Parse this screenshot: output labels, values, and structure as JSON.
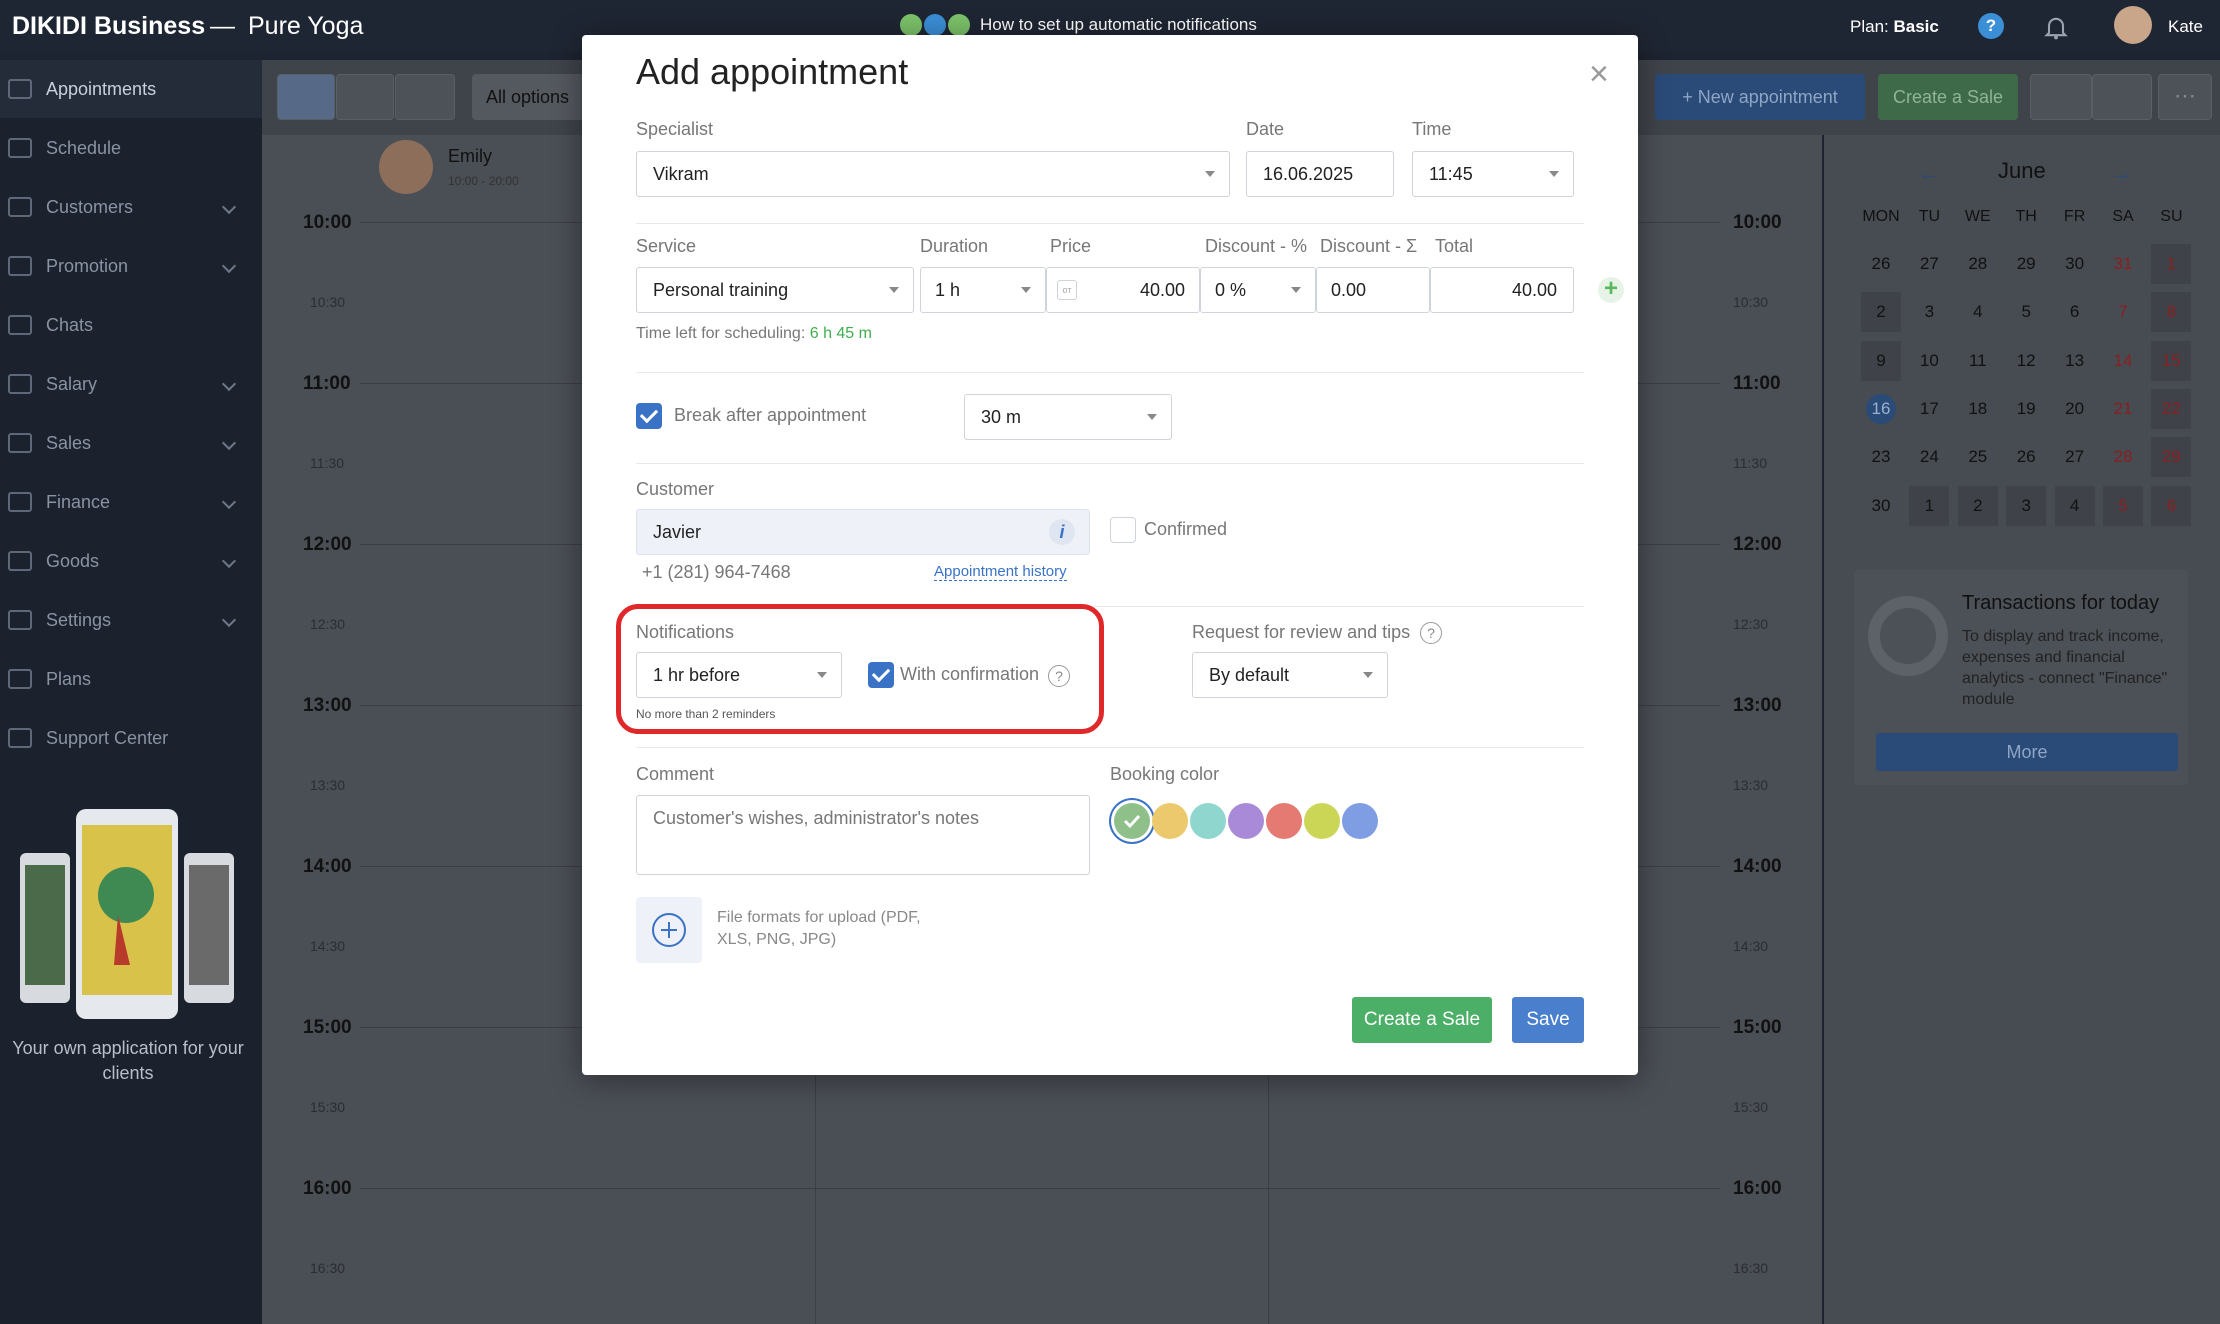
{
  "topbar": {
    "brand": "DIKIDI Business",
    "separator": "—",
    "company": "Pure Yoga",
    "promo_text": "How to set up automatic notifications",
    "plan_label": "Plan:",
    "plan_value": "Basic",
    "help_icon": "?",
    "user_name": "Kate"
  },
  "sidebar": {
    "items": [
      {
        "label": "Appointments",
        "icon": "calendar-icon",
        "active": true,
        "expandable": false
      },
      {
        "label": "Schedule",
        "icon": "schedule-icon",
        "active": false,
        "expandable": false
      },
      {
        "label": "Customers",
        "icon": "users-icon",
        "active": false,
        "expandable": true
      },
      {
        "label": "Promotion",
        "icon": "rocket-icon",
        "active": false,
        "expandable": true
      },
      {
        "label": "Chats",
        "icon": "chat-icon",
        "active": false,
        "expandable": false
      },
      {
        "label": "Salary",
        "icon": "salary-icon",
        "active": false,
        "expandable": true
      },
      {
        "label": "Sales",
        "icon": "sales-icon",
        "active": false,
        "expandable": true
      },
      {
        "label": "Finance",
        "icon": "finance-icon",
        "active": false,
        "expandable": true
      },
      {
        "label": "Goods",
        "icon": "goods-icon",
        "active": false,
        "expandable": true
      },
      {
        "label": "Settings",
        "icon": "gear-icon",
        "active": false,
        "expandable": true
      },
      {
        "label": "Plans",
        "icon": "layers-icon",
        "active": false,
        "expandable": false
      },
      {
        "label": "Support Center",
        "icon": "help-icon",
        "active": false,
        "expandable": false
      }
    ],
    "app_promo": "Your own application for your clients"
  },
  "calendar": {
    "view_filter": "All options",
    "staff_name": "Emily",
    "staff_hours": "10:00 - 20:00",
    "hours": [
      "10:00",
      "11:00",
      "12:00",
      "13:00",
      "14:00",
      "15:00",
      "16:00"
    ],
    "half_hours": [
      "10:30",
      "11:30",
      "12:30",
      "13:30",
      "14:30",
      "15:30",
      "16:30"
    ]
  },
  "right_panel": {
    "new_appointment": "New appointment",
    "create_sale": "Create a Sale",
    "more_icon": "⋯",
    "month": "June",
    "weekdays": [
      "MON",
      "TU",
      "WE",
      "TH",
      "FR",
      "SA",
      "SU"
    ],
    "weeks": [
      [
        "26",
        "27",
        "28",
        "29",
        "30",
        "31",
        "1"
      ],
      [
        "2",
        "3",
        "4",
        "5",
        "6",
        "7",
        "8"
      ],
      [
        "9",
        "10",
        "11",
        "12",
        "13",
        "14",
        "15"
      ],
      [
        "16",
        "17",
        "18",
        "19",
        "20",
        "21",
        "22"
      ],
      [
        "23",
        "24",
        "25",
        "26",
        "27",
        "28",
        "29"
      ],
      [
        "30",
        "1",
        "2",
        "3",
        "4",
        "5",
        "6"
      ]
    ],
    "today": "16",
    "transactions_title": "Transactions for today",
    "transactions_text": "To display and track income, expenses and financial analytics - connect \"Finance\" module",
    "more_button": "More"
  },
  "modal": {
    "title": "Add appointment",
    "close_icon": "×",
    "specialist_label": "Specialist",
    "specialist_value": "Vikram",
    "date_label": "Date",
    "date_value": "16.06.2025",
    "time_label": "Time",
    "time_value": "11:45",
    "service_label": "Service",
    "service_value": "Personal training",
    "duration_label": "Duration",
    "duration_value": "1 h",
    "price_label": "Price",
    "price_value": "40.00",
    "price_badge": "от",
    "discount_pct_label": "Discount - %",
    "discount_pct_value": "0 %",
    "discount_sum_label": "Discount - Σ",
    "discount_sum_value": "0.00",
    "total_label": "Total",
    "total_value": "40.00",
    "add_service_icon": "+",
    "time_left_label": "Time left for scheduling:",
    "time_left_value": "6 h 45 m",
    "break_label": "Break after appointment",
    "break_checked": true,
    "break_value": "30 m",
    "customer_label": "Customer",
    "customer_value": "Javier",
    "customer_info_icon": "i",
    "confirmed_label": "Confirmed",
    "confirmed_checked": false,
    "customer_phone": "+1 (281) 964-7468",
    "appointment_history": "Appointment history",
    "notifications_label": "Notifications",
    "notifications_value": "1 hr before",
    "with_confirmation_label": "With confirmation",
    "with_confirmation_checked": true,
    "reminders_note": "No more than 2 reminders",
    "review_label": "Request for review and tips",
    "review_value": "By default",
    "comment_label": "Comment",
    "comment_placeholder": "Customer's wishes, administrator's notes",
    "booking_color_label": "Booking color",
    "booking_colors": [
      "#8fc08a",
      "#ecc96c",
      "#8fd6cf",
      "#a98ad8",
      "#e57a72",
      "#cbd657",
      "#7f9de2"
    ],
    "selected_color": "#8fc08a",
    "upload_text": "File formats for upload (PDF, XLS, PNG, JPG)",
    "create_sale_button": "Create a Sale",
    "save_button": "Save"
  },
  "colors": {
    "highlight": "#e0282b",
    "accent_green": "#4caf68",
    "accent_blue": "#4a7fce"
  }
}
